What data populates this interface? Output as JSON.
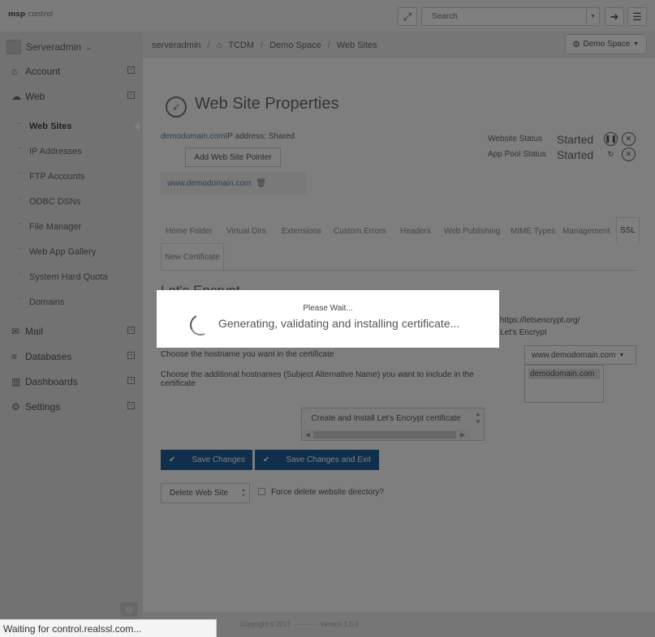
{
  "topbar": {
    "logo_text": "msp",
    "logo_text2": "control",
    "search_placeholder": "Search"
  },
  "sidebar": {
    "username": "Serveradmin",
    "sections": [
      {
        "label": "Account",
        "icon": "home-icon"
      },
      {
        "label": "Web",
        "icon": "cloud-icon"
      },
      {
        "label": "Mail",
        "icon": "envelope-icon"
      },
      {
        "label": "Databases",
        "icon": "database-icon"
      },
      {
        "label": "Dashboards",
        "icon": "chart-icon"
      },
      {
        "label": "Settings",
        "icon": "gear-icon"
      }
    ],
    "web_items": [
      "Web Sites",
      "IP Addresses",
      "FTP Accounts",
      "ODBC DSNs",
      "File Manager",
      "Web App Gallery",
      "System Hard Quota",
      "Domains"
    ]
  },
  "breadcrumb": {
    "items": [
      "serveradmin",
      "TCDM",
      "Demo Space",
      "Web Sites"
    ],
    "space_button": "Demo Space"
  },
  "main": {
    "title": "Web Site Properties",
    "domain": "demodomain.com",
    "ip_text": "IP address: Shared",
    "add_pointer_button": "Add Web Site Pointer",
    "pointer": "www.demodomain.com",
    "website_status_label": "Website Status",
    "website_status_value": "Started",
    "apppool_status_label": "App Pool Status",
    "apppool_status_value": "Started",
    "tabs": [
      "Home Folder",
      "Virtual Dirs",
      "Extensions",
      "Custom Errors",
      "Headers",
      "Web Publishing",
      "MIME Types",
      "Management",
      "SSL"
    ],
    "subtab": "New Certificate",
    "ssl_heading": "Let's Encrypt",
    "ssl_url_fragment": "https://letsencrypt.org/",
    "ssl_line2_fragment": "Let's Encrypt",
    "hostname_label": "Choose the hostname you want in the certificate",
    "hostname_value": "www.demodomain.com",
    "san_label": "Choose the additional hostnames (Subject Alternative Name) you want to include in the certificate",
    "san_selected": "demodomain.com",
    "create_button": "Create and Install Let's Encrypt certificate",
    "save_button": "Save Changes",
    "save_exit_button": "Save Changes and Exit",
    "delete_button": "Delete Web Site",
    "force_delete_label": "Force delete website directory?"
  },
  "footer": {
    "text": "Copyright © 2017 ············ Version 1.0.0"
  },
  "modal": {
    "title": "Please Wait...",
    "message": "Generating, validating and installing certificate..."
  },
  "statusbar": {
    "text": "Waiting for control.realssl.com..."
  },
  "colors": {
    "primary": "#1f5f99",
    "link": "#5b81a8",
    "overlay": "rgba(0,0,0,0.5)"
  }
}
